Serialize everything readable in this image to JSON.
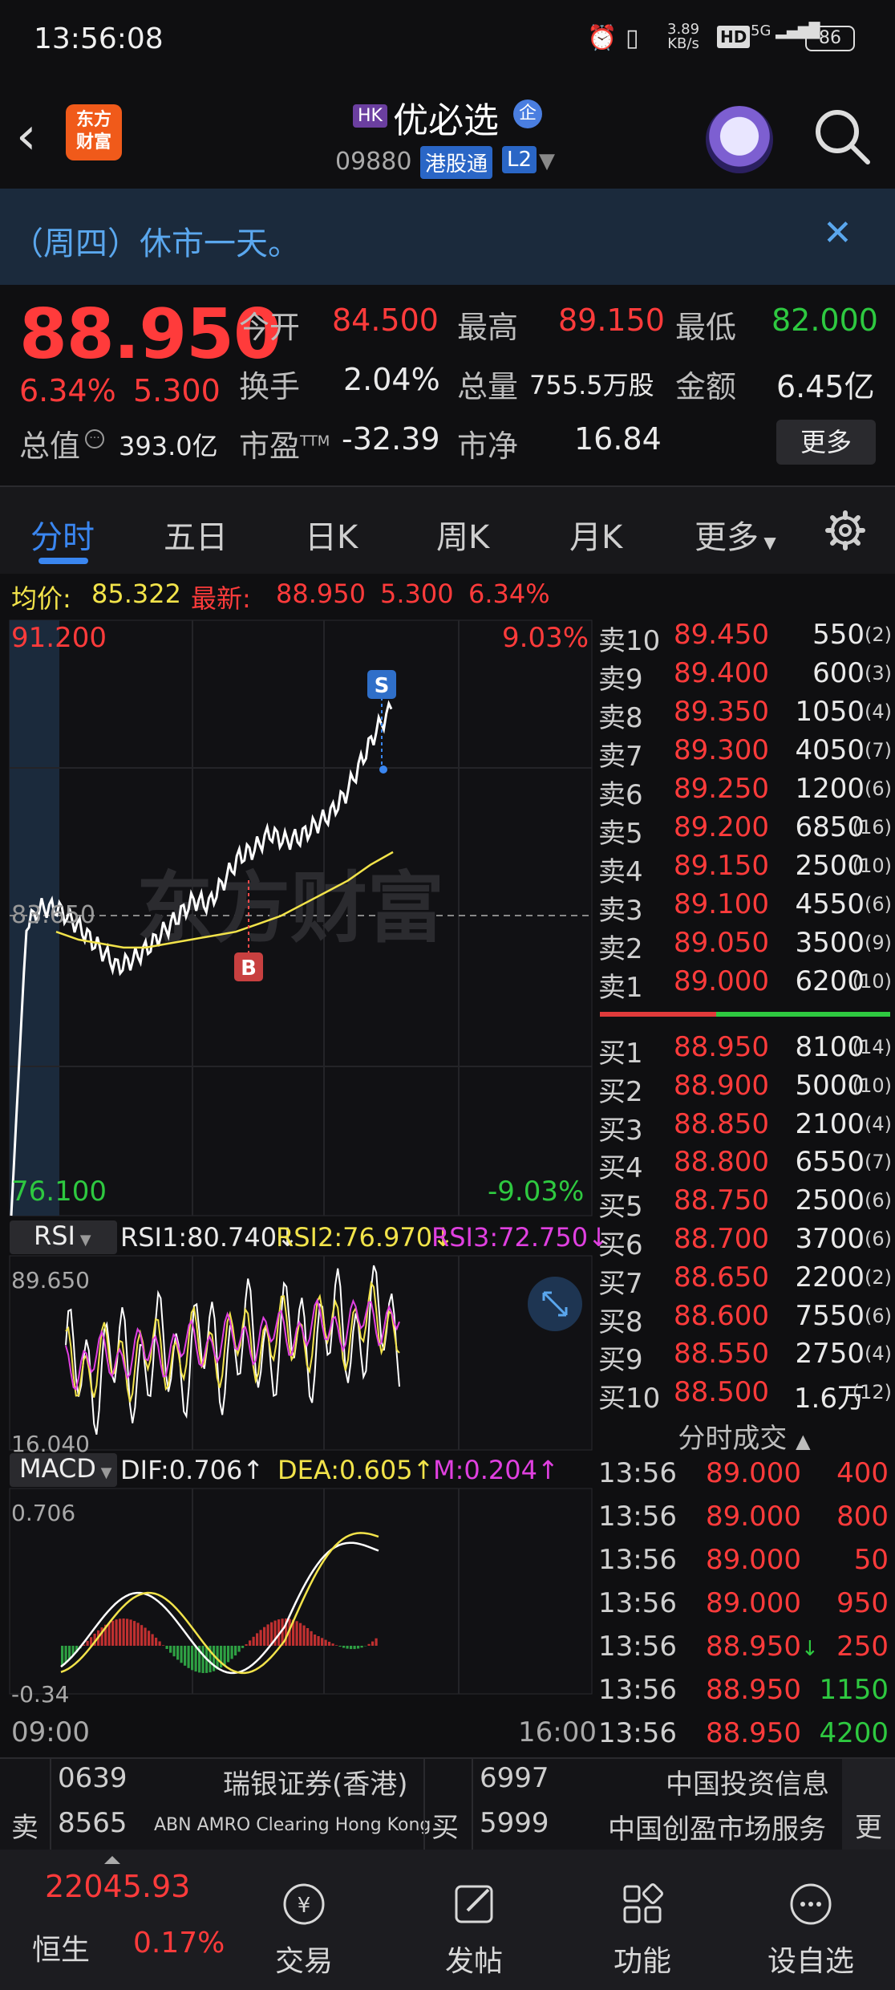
{
  "status_bar": {
    "time": "13:56:08",
    "net_speed_value": "3.89",
    "net_speed_unit": "KB/s",
    "hd_badge": "HD",
    "signal_label": "5G",
    "battery": "86"
  },
  "header": {
    "app_logo_line1": "东方",
    "app_logo_line2": "财富",
    "market_badge": "HK",
    "stock_name": "优必选",
    "stock_tag": "企",
    "stock_code": "09880",
    "connect_badge": "港股通",
    "level_badge": "L2"
  },
  "notice": {
    "text": "（周四）休市一天。"
  },
  "quote": {
    "price": "88.950",
    "change_pct": "6.34%",
    "change": "5.300",
    "open_label": "今开",
    "open": "84.500",
    "high_label": "最高",
    "high": "89.150",
    "low_label": "最低",
    "low": "82.000",
    "turnover_label": "换手",
    "turnover": "2.04%",
    "volume_label": "总量",
    "volume": "755.5万股",
    "amount_label": "金额",
    "amount": "6.45亿",
    "mktcap_label": "总值",
    "mktcap": "393.0亿",
    "pe_label": "市盈",
    "pe_sup": "TTM",
    "pe": "-32.39",
    "pb_label": "市净",
    "pb": "16.84",
    "more_label": "更多"
  },
  "tabs": [
    "分时",
    "五日",
    "日K",
    "周K",
    "月K",
    "更多"
  ],
  "avg_row": {
    "avg_label": "均价:",
    "avg": "85.322",
    "latest_label": "最新:",
    "latest": "88.950",
    "change": "5.300",
    "change_pct": "6.34%"
  },
  "chart_labels": {
    "price_max": "91.200",
    "price_min": "76.100",
    "pct_max": "9.03%",
    "pct_min": "-9.03%",
    "prev_close": "83.650",
    "watermark": "东方财富",
    "signal_b": "B",
    "signal_s": "S",
    "rsi_selector": "RSI",
    "rsi1": "RSI1:80.740↓",
    "rsi2": "RSI2:76.970↓",
    "rsi3": "RSI3:72.750↓",
    "rsi_max": "89.650",
    "rsi_min": "16.040",
    "macd_selector": "MACD",
    "dif": "DIF:0.706↑",
    "dea": "DEA:0.605↑",
    "m": "M:0.204↑",
    "macd_max": "0.706",
    "macd_min": "-0.34",
    "time_start": "09:00",
    "time_end": "16:00"
  },
  "chart_data": {
    "type": "line",
    "series": [
      {
        "name": "价格",
        "values": [
          76.1,
          83.5,
          83.9,
          83.9,
          83.6,
          83.2,
          82.8,
          82.4,
          82.6,
          82.9,
          83.3,
          83.7,
          84.1,
          84.0,
          84.6,
          85.2,
          85.4,
          85.8,
          85.6,
          85.7,
          86.0,
          86.3,
          86.8,
          87.6,
          88.4,
          88.95
        ]
      },
      {
        "name": "均价",
        "values": [
          83.3,
          83.1,
          83.0,
          82.9,
          82.9,
          83.0,
          83.1,
          83.2,
          83.3,
          83.5,
          83.7,
          84.0,
          84.3,
          84.6,
          85.0,
          85.32
        ]
      }
    ],
    "ylim": [
      76.1,
      91.2
    ],
    "x": [
      "09:00",
      "16:00"
    ]
  },
  "order_book": {
    "asks": [
      {
        "label": "卖10",
        "price": "89.450",
        "vol": "550",
        "n": "(2)"
      },
      {
        "label": "卖9",
        "price": "89.400",
        "vol": "600",
        "n": "(3)"
      },
      {
        "label": "卖8",
        "price": "89.350",
        "vol": "1050",
        "n": "(4)"
      },
      {
        "label": "卖7",
        "price": "89.300",
        "vol": "4050",
        "n": "(7)"
      },
      {
        "label": "卖6",
        "price": "89.250",
        "vol": "1200",
        "n": "(6)"
      },
      {
        "label": "卖5",
        "price": "89.200",
        "vol": "6850",
        "n": "(16)"
      },
      {
        "label": "卖4",
        "price": "89.150",
        "vol": "2500",
        "n": "(10)"
      },
      {
        "label": "卖3",
        "price": "89.100",
        "vol": "4550",
        "n": "(6)"
      },
      {
        "label": "卖2",
        "price": "89.050",
        "vol": "3500",
        "n": "(9)"
      },
      {
        "label": "卖1",
        "price": "89.000",
        "vol": "6200",
        "n": "(10)"
      }
    ],
    "bids": [
      {
        "label": "买1",
        "price": "88.950",
        "vol": "8100",
        "n": "(14)"
      },
      {
        "label": "买2",
        "price": "88.900",
        "vol": "5000",
        "n": "(10)"
      },
      {
        "label": "买3",
        "price": "88.850",
        "vol": "2100",
        "n": "(4)"
      },
      {
        "label": "买4",
        "price": "88.800",
        "vol": "6550",
        "n": "(7)"
      },
      {
        "label": "买5",
        "price": "88.750",
        "vol": "2500",
        "n": "(6)"
      },
      {
        "label": "买6",
        "price": "88.700",
        "vol": "3700",
        "n": "(6)"
      },
      {
        "label": "买7",
        "price": "88.650",
        "vol": "2200",
        "n": "(2)"
      },
      {
        "label": "买8",
        "price": "88.600",
        "vol": "7550",
        "n": "(6)"
      },
      {
        "label": "买9",
        "price": "88.550",
        "vol": "2750",
        "n": "(4)"
      },
      {
        "label": "买10",
        "price": "88.500",
        "vol": "1.6万",
        "n": "(12)"
      }
    ]
  },
  "ticks": {
    "header": "分时成交",
    "rows": [
      {
        "time": "13:56",
        "price": "89.000",
        "vol": "400",
        "dir": ""
      },
      {
        "time": "13:56",
        "price": "89.000",
        "vol": "800",
        "dir": ""
      },
      {
        "time": "13:56",
        "price": "89.000",
        "vol": "50",
        "dir": ""
      },
      {
        "time": "13:56",
        "price": "89.000",
        "vol": "950",
        "dir": ""
      },
      {
        "time": "13:56",
        "price": "88.950",
        "vol": "250",
        "dir": "↓"
      },
      {
        "time": "13:56",
        "price": "88.950",
        "vol": "1150",
        "dir": ""
      },
      {
        "time": "13:56",
        "price": "88.950",
        "vol": "4200",
        "dir": ""
      }
    ]
  },
  "broker": {
    "sell_label": "卖",
    "buy_label": "买",
    "more_label": "更",
    "sell": [
      {
        "code": "0639",
        "name": "瑞银证券(香港)"
      },
      {
        "code": "8565",
        "name": "ABN AMRO Clearing Hong Kong"
      }
    ],
    "buy": [
      {
        "code": "6997",
        "name": "中国投资信息"
      },
      {
        "code": "5999",
        "name": "中国创盈市场服务"
      }
    ]
  },
  "bottom_nav": {
    "index_value": "22045.93",
    "index_name": "恒生",
    "index_pct": "0.17%",
    "items": [
      "交易",
      "发帖",
      "功能",
      "设自选"
    ]
  }
}
